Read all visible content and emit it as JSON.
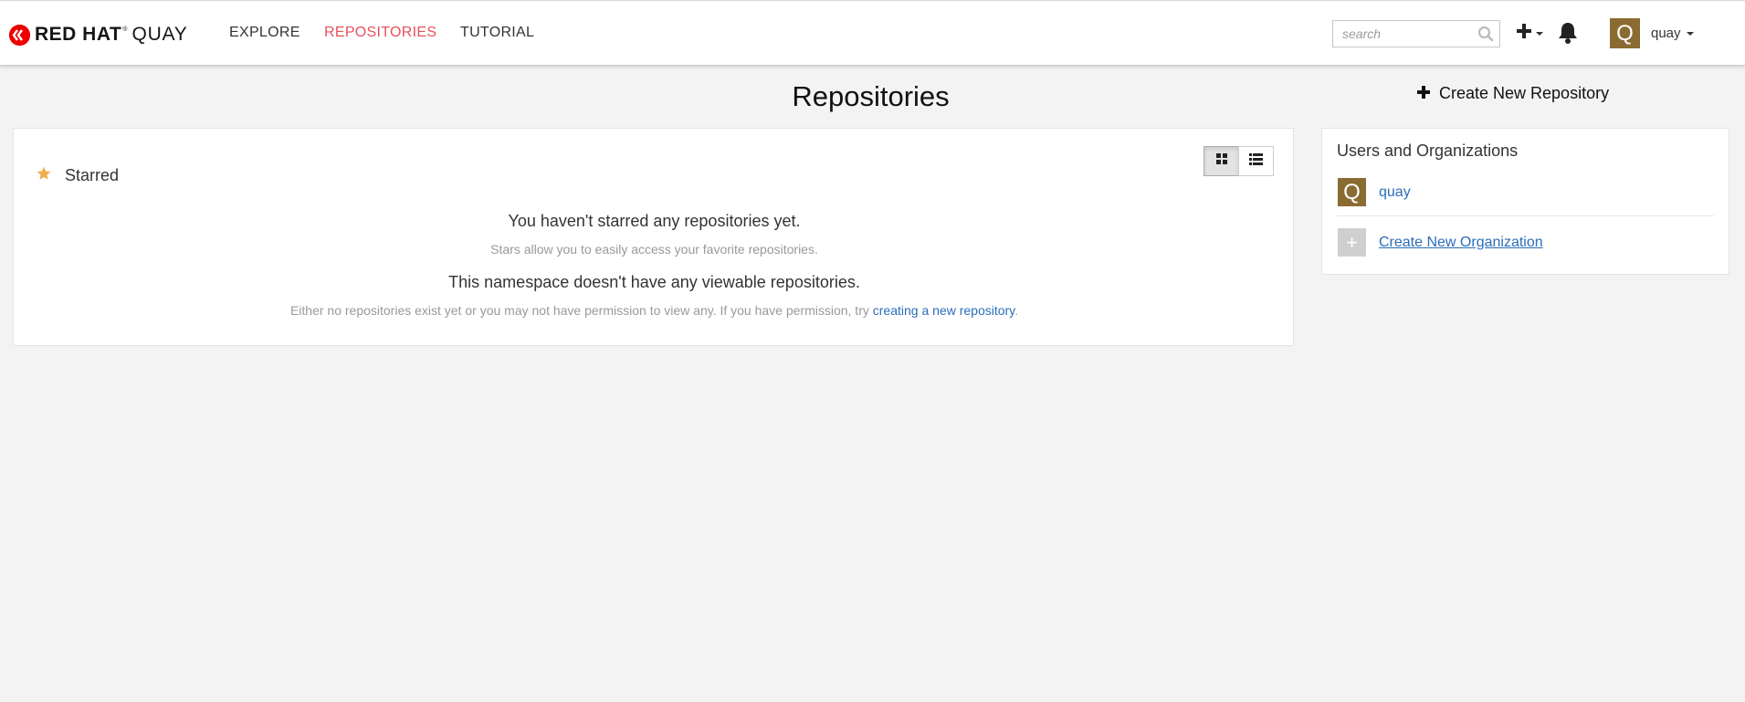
{
  "nav": {
    "brand_red": "RED HAT",
    "brand_reg": "®",
    "brand_quay": "QUAY",
    "links": [
      {
        "label": "EXPLORE"
      },
      {
        "label": "REPOSITORIES",
        "active": true
      },
      {
        "label": "TUTORIAL"
      }
    ],
    "search_placeholder": "search",
    "user": {
      "avatar_letter": "Q",
      "name": "quay"
    },
    "colors": {
      "active_link": "#e7505c",
      "avatar_bg": "#8a6b32",
      "brand_logo": "#ee0000"
    }
  },
  "page": {
    "title": "Repositories",
    "create_repo_label": "Create New Repository"
  },
  "starred": {
    "header": "Starred",
    "view_modes": [
      "grid-icon",
      "list-icon"
    ],
    "active_view": "grid",
    "empty_title": "You haven't starred any repositories yet.",
    "empty_sub": "Stars allow you to easily access your favorite repositories.",
    "namespace_title": "This namespace doesn't have any viewable repositories.",
    "namespace_sub": "Either no repositories exist yet or you may not have permission to view any. If you have permission, try ",
    "namespace_link": "creating a new repository",
    "namespace_sub_end": "."
  },
  "orgs": {
    "title": "Users and Organizations",
    "items": [
      {
        "avatar_letter": "Q",
        "label": "quay"
      },
      {
        "avatar_letter": "+",
        "label": "Create New Organization"
      }
    ],
    "colors": {
      "link": "#2a6ebb",
      "star": "#f0ad4e"
    }
  }
}
